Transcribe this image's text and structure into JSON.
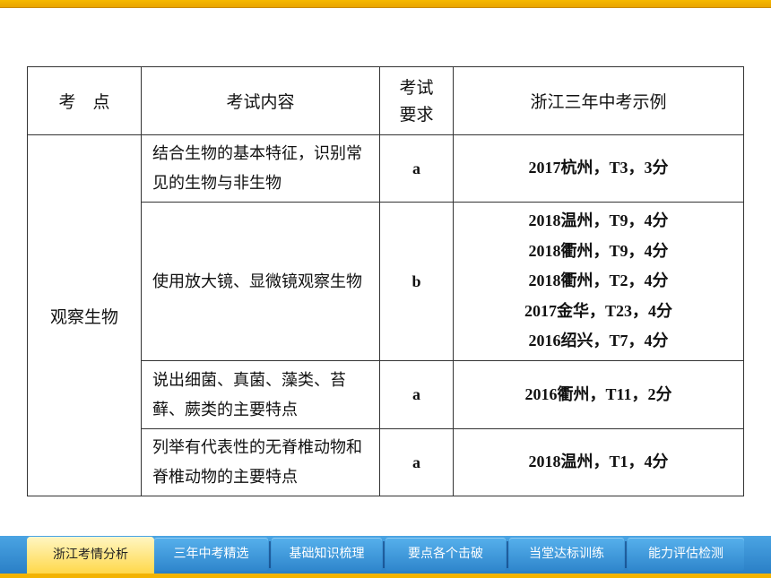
{
  "table": {
    "headers": {
      "point": "考　点",
      "content": "考试内容",
      "requirement": "考试\n要求",
      "examples": "浙江三年中考示例"
    },
    "point": "观察生物",
    "rows": [
      {
        "content": "结合生物的基本特征，识别常见的生物与非生物",
        "requirement": "a",
        "examples": [
          "2017杭州，T3，3分"
        ]
      },
      {
        "content": "使用放大镜、显微镜观察生物",
        "requirement": "b",
        "examples": [
          "2018温州，T9，4分",
          "2018衢州，T9，4分",
          "2018衢州，T2，4分",
          "2017金华，T23，4分",
          "2016绍兴，T7，4分"
        ]
      },
      {
        "content": "说出细菌、真菌、藻类、苔藓、蕨类的主要特点",
        "requirement": "a",
        "examples": [
          "2016衢州，T11，2分"
        ]
      },
      {
        "content": "列举有代表性的无脊椎动物和脊椎动物的主要特点",
        "requirement": "a",
        "examples": [
          "2018温州，T1，4分"
        ]
      }
    ]
  },
  "nav": {
    "active_index": 0,
    "tabs": [
      "浙江考情分析",
      "三年中考精选",
      "基础知识梳理",
      "要点各个击破",
      "当堂达标训练",
      "能力评估检测"
    ]
  },
  "colors": {
    "accent_bar": "#f3b300",
    "nav_blue": "#3a92d6",
    "active_tab": "#ffe066"
  }
}
